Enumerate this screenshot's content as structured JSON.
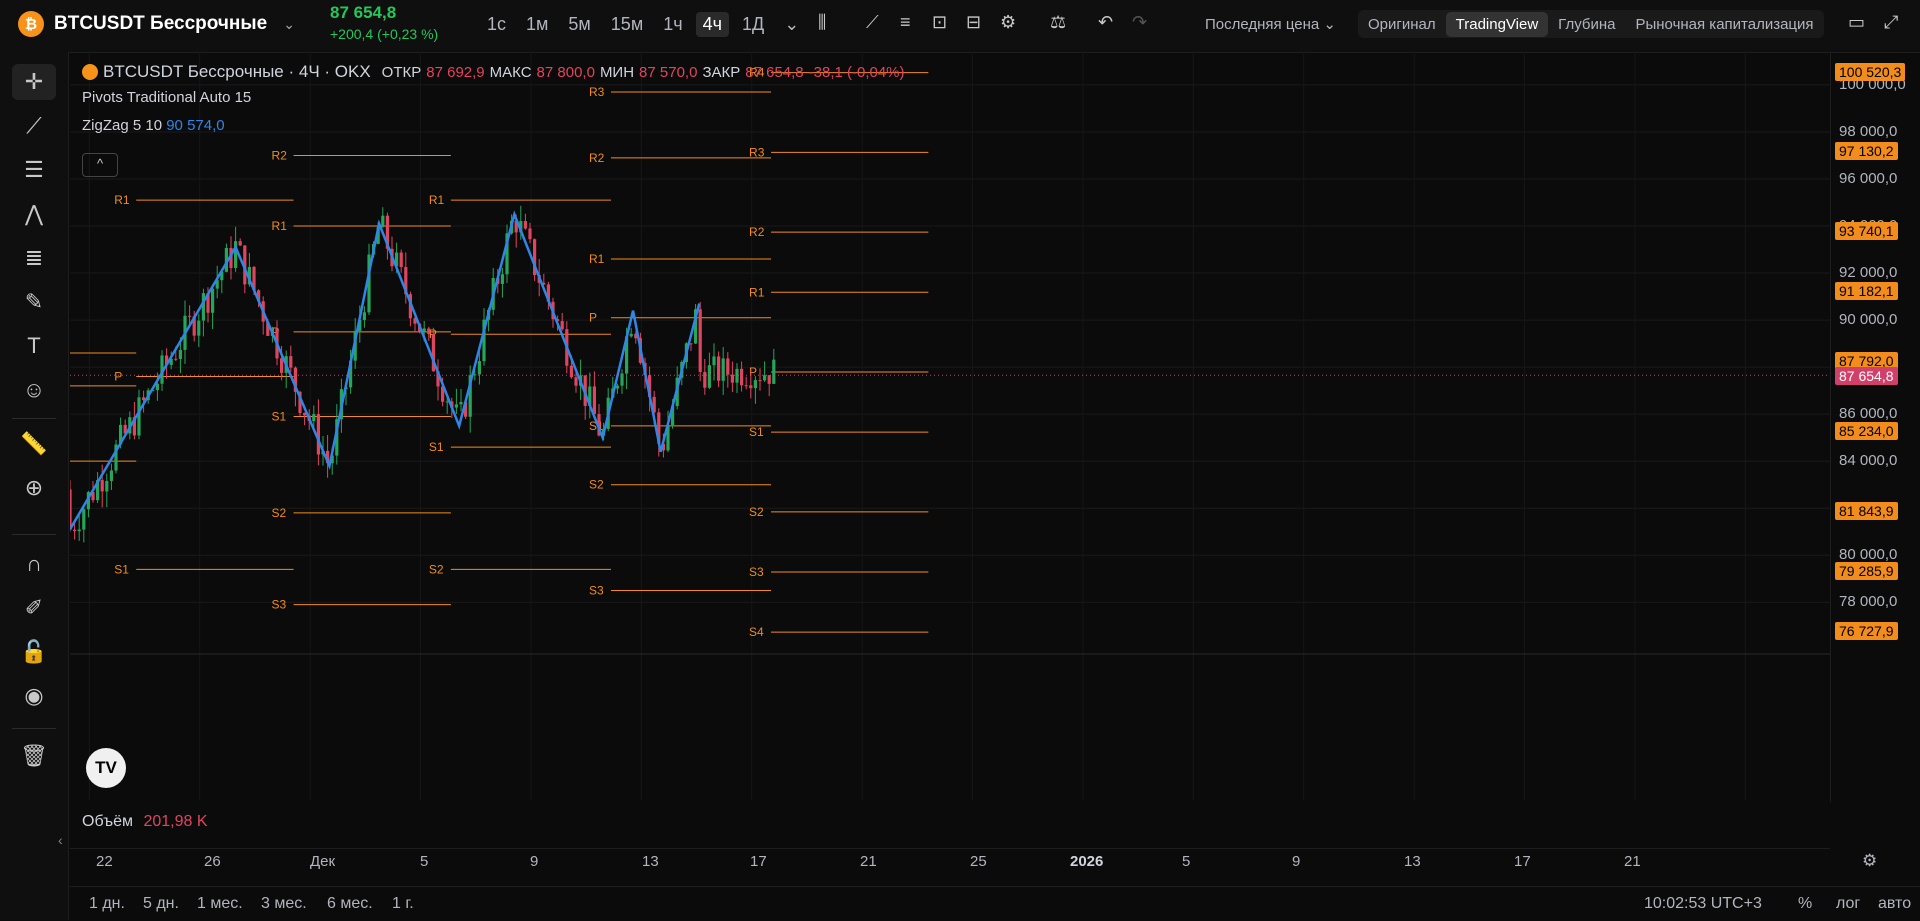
{
  "header": {
    "symbol_icon": "bitcoin-icon",
    "symbol": "BTCUSDT Бессрочные",
    "price": "87 654,8",
    "change": "+200,4 (+0,23 %)",
    "timeframes": [
      "1с",
      "1м",
      "5м",
      "15м",
      "1ч",
      "4ч",
      "1Д"
    ],
    "active_timeframe": "4ч",
    "price_source": "Последняя цена",
    "views": [
      "Оригинал",
      "TradingView",
      "Глубина",
      "Рыночная капитализация"
    ],
    "active_view": "TradingView"
  },
  "legend": {
    "title": "BTCUSDT Бессрочные · 4Ч · OKX",
    "open_label": "ОТКР",
    "open": "87 692,9",
    "high_label": "МАКС",
    "high": "87 800,0",
    "low_label": "МИН",
    "low": "87 570,0",
    "close_label": "ЗАКР",
    "close": "87 654,8",
    "change": "-38,1 (-0,04%)",
    "pivots": "Pivots Traditional Auto 15",
    "zigzag": "ZigZag 5 10",
    "zigzag_value": "90 574,0",
    "collapse": "^"
  },
  "volume": {
    "label": "Объём",
    "value": "201,98 K"
  },
  "price_axis": {
    "ticks": [
      "100 000,0",
      "98 000,0",
      "96 000,0",
      "94 000,0",
      "92 000,0",
      "90 000,0",
      "88 000,0",
      "86 000,0",
      "84 000,0",
      "82 000,0",
      "80 000,0",
      "78 000,0"
    ],
    "tick_values": [
      100000,
      98000,
      96000,
      94000,
      92000,
      90000,
      88000,
      86000,
      84000,
      82000,
      80000,
      78000
    ],
    "labels": [
      "100 520,3",
      "97 130,2",
      "93 740,1",
      "91 182,1",
      "87 792,0",
      "87 654,8",
      "85 234,0",
      "81 843,9",
      "79 285,9",
      "76 727,9"
    ]
  },
  "time_axis": [
    "22",
    "26",
    "Дек",
    "5",
    "9",
    "13",
    "17",
    "21",
    "25",
    "2026",
    "5",
    "9",
    "13",
    "17",
    "21"
  ],
  "ranges": [
    "1 дн.",
    "5 дн.",
    "1 мес.",
    "3 мес.",
    "6 мес.",
    "1 г."
  ],
  "status": {
    "time": "10:02:53 UTC+3",
    "percent": "%",
    "log": "лог",
    "auto": "авто"
  },
  "tv_logo": "TV",
  "pivot_labels": [
    "R1",
    "P",
    "S1",
    "R2",
    "R1",
    "P",
    "S1",
    "S2",
    "S3",
    "R1",
    "P",
    "S1",
    "S2",
    "R3",
    "R2",
    "R1",
    "P",
    "S1",
    "S2",
    "S3",
    "R4",
    "R3",
    "R2",
    "R1",
    "P",
    "S1",
    "S2",
    "S3",
    "S4"
  ],
  "chart_data": {
    "type": "candlestick",
    "title": "BTCUSDT Бессрочные · 4Ч · OKX",
    "ylim": [
      75800,
      101400
    ],
    "zigzag": [
      [
        0,
        81100
      ],
      [
        6,
        93100
      ],
      [
        9.4,
        83800
      ],
      [
        11.2,
        94100
      ],
      [
        14.1,
        85500
      ],
      [
        16.1,
        94500
      ],
      [
        19.3,
        85000
      ],
      [
        20.4,
        90400
      ],
      [
        21.4,
        84400
      ],
      [
        22.8,
        90700
      ]
    ],
    "pivot_segments": [
      {
        "period": 1,
        "levels": {
          "R1": 95100,
          "P": 87600,
          "S1": 79400
        }
      },
      {
        "period": 2,
        "levels": {
          "R2": 97000,
          "R1": 94000,
          "P": 89500,
          "S1": 85900,
          "S2": 81800,
          "S3": 77900
        }
      },
      {
        "period": 3,
        "levels": {
          "R1": 95100,
          "P": 89400,
          "S1": 84600,
          "S2": 79400
        }
      },
      {
        "period": 4,
        "levels": {
          "R3": 99700,
          "R2": 96900,
          "R1": 92600,
          "P": 90100,
          "S1": 85500,
          "S2": 83000,
          "S3": 78500
        }
      },
      {
        "period": 5,
        "levels": {
          "R4": 100520.3,
          "R3": 97130.2,
          "R2": 93740.1,
          "R1": 91182.1,
          "P": 87792.0,
          "S1": 85234.0,
          "S2": 81843.9,
          "S3": 79285.9,
          "S4": 76727.9
        }
      }
    ],
    "last_price": 87654.8
  }
}
